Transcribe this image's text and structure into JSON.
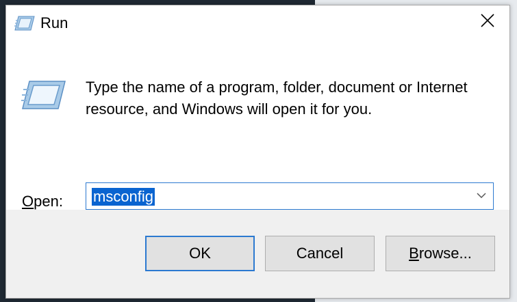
{
  "dialog": {
    "title": "Run",
    "close_icon": "close-icon",
    "app_icon": "run-icon",
    "description": "Type the name of a program, folder, document or Internet resource, and Windows will open it for you.",
    "open_label_accel": "O",
    "open_label_rest": "pen:",
    "command_value": "msconfig",
    "dropdown_icon": "chevron-down-icon"
  },
  "buttons": {
    "ok": "OK",
    "cancel": "Cancel",
    "browse_accel": "B",
    "browse_rest": "rowse..."
  },
  "colors": {
    "accent": "#2b79d0",
    "selection": "#0a64d0",
    "footer_bg": "#f0f0f0",
    "button_bg": "#e1e1e1"
  }
}
